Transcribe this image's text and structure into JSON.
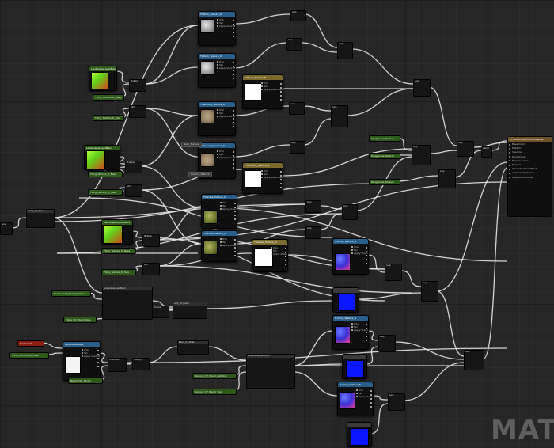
{
  "editor": {
    "watermark": "MATE",
    "result_node": {
      "title": "M_Landscape_Auto_Material",
      "inputs": [
        "Base Color",
        "Metallic",
        "Specular",
        "Roughness",
        "Emissive Color",
        "",
        "Normal",
        "",
        "World Position Offset",
        "",
        "",
        "",
        "",
        "Ambient Occlusion",
        "",
        "Pixel Depth Offset"
      ]
    },
    "texture_nodes": [
      {
        "title": "TXRock_Texture_D",
        "preview": "grey"
      },
      {
        "title": "TXRock_Texture_D",
        "preview": "grey"
      },
      {
        "title": "TXGround_Texture_D",
        "preview": "tan"
      },
      {
        "title": "TXGround_Texture_D",
        "preview": "tan"
      },
      {
        "title": "TXGrass_Texture_D",
        "preview": "moss"
      },
      {
        "title": "TXGrass_Texture_D",
        "preview": "moss"
      },
      {
        "title": "TXRock_Texture_N",
        "preview": "white"
      },
      {
        "title": "TXGround_Texture_N",
        "preview": "white"
      },
      {
        "title": "TXGrass_Texture_N",
        "preview": "white"
      },
      {
        "title": "Normal_Texture_N",
        "preview": "normal"
      },
      {
        "title": "Normal_Texture_N",
        "preview": "normal"
      },
      {
        "title": "Normal_Texture_N",
        "preview": "normal"
      },
      {
        "title": "Texture Sample",
        "preview": "white2"
      }
    ],
    "texture_pins": [
      "UVs",
      "Tex",
      "Apply View MipBias"
    ],
    "texture_outputs": [
      "RGB",
      "R",
      "G",
      "B",
      "A",
      "RGBA"
    ],
    "layer_blend_nodes": [
      {
        "title": "LandscapeLayerBlend"
      },
      {
        "title": "LandscapeLayerBlend"
      },
      {
        "title": "LandscapeLayerBlend"
      }
    ],
    "params": [
      {
        "label": "Tiling_Texture_D_Base",
        "color": "green"
      },
      {
        "label": "Tiling_Texture_D_Size",
        "color": "green"
      },
      {
        "label": "Tiling_Texture_D_Base",
        "color": "green"
      },
      {
        "label": "Tiling_Texture_D_Size",
        "color": "green"
      },
      {
        "label": "Tiling_Texture_D_Base",
        "color": "green"
      },
      {
        "label": "Tiling_Texture_D_Size",
        "color": "green"
      },
      {
        "label": "Roughness_Texture",
        "color": "green"
      },
      {
        "label": "Roughness_Texture",
        "color": "green"
      },
      {
        "label": "Roughness_Texture",
        "color": "green"
      },
      {
        "label": "Texture_UV_World_Position",
        "color": "green"
      },
      {
        "label": "Tiling_UV_Blend_Size",
        "color": "green"
      },
      {
        "label": "TextureAlt",
        "color": "red"
      },
      {
        "label": "Slide_Landscape_Mask",
        "color": "green"
      },
      {
        "label": "Blend_Tile_Factor",
        "color": "green"
      },
      {
        "label": "Texture_UV_World_Rotation",
        "color": "green"
      },
      {
        "label": "Texture_UV_Blend_Size",
        "color": "green"
      }
    ],
    "labels": [
      "Multiply",
      "Add",
      "Lerp",
      "Clamp",
      "Sine",
      "Time",
      "Panner",
      "OneMinus",
      "Clamp_UV_Blend",
      "Lerp_UV_Blend",
      "Blend_UV_Mask",
      "TexCoord"
    ],
    "tags": [
      "Rock_Texture",
      "Ground_Texture"
    ]
  }
}
